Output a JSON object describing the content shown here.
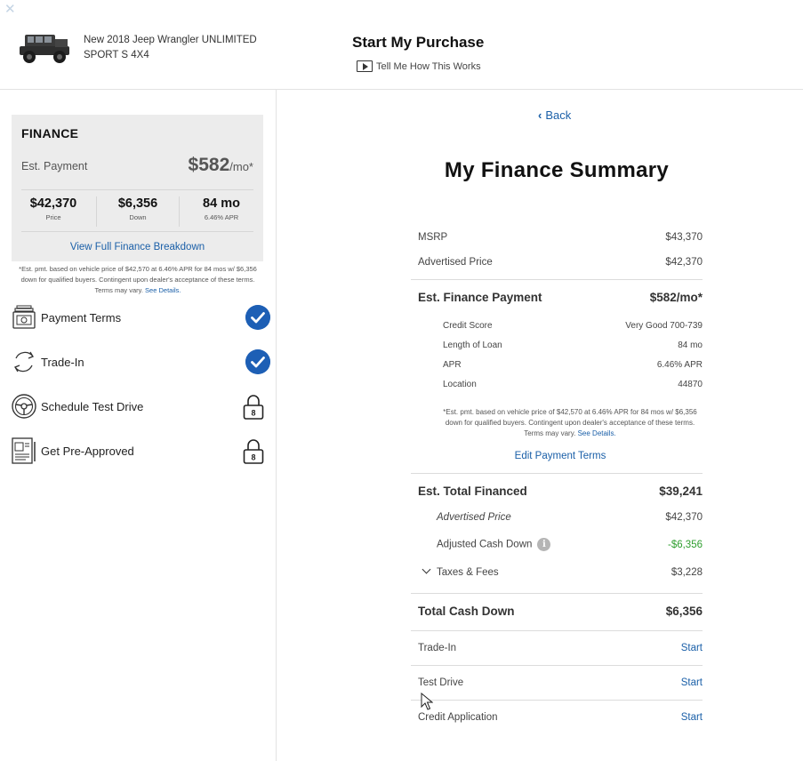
{
  "header": {
    "close_glyph": "✕",
    "vehicle_name": "New 2018 Jeep Wrangler UNLIMITED SPORT S 4X4",
    "title": "Start My Purchase",
    "how_it_works": "Tell Me How This Works"
  },
  "finance_card": {
    "title": "FINANCE",
    "est_label": "Est. Payment",
    "est_amount": "$582",
    "est_suffix": "/mo*",
    "stats": [
      {
        "value": "$42,370",
        "label": "Price"
      },
      {
        "value": "$6,356",
        "label": "Down"
      },
      {
        "value": "84 mo",
        "label": "6.46% APR"
      }
    ],
    "breakdown_link": "View Full Finance Breakdown"
  },
  "left_disclaimer": {
    "text": "*Est. pmt. based on vehicle price of $42,570 at 6.46% APR for 84 mos w/ $6,356 down for qualified buyers. Contingent upon dealer's acceptance of these terms. Terms may vary.",
    "link": "See Details."
  },
  "steps": [
    {
      "label": "Payment Terms",
      "status": "complete"
    },
    {
      "label": "Trade-In",
      "status": "complete"
    },
    {
      "label": "Schedule Test Drive",
      "status": "locked",
      "lock_number": "8"
    },
    {
      "label": "Get Pre-Approved",
      "status": "locked",
      "lock_number": "8"
    }
  ],
  "summary": {
    "back": "Back",
    "title": "My Finance Summary",
    "msrp_label": "MSRP",
    "msrp_value": "$43,370",
    "adv_label": "Advertised Price",
    "adv_value": "$42,370",
    "est_payment_label": "Est. Finance Payment",
    "est_payment_value": "$582/mo*",
    "details": [
      {
        "label": "Credit Score",
        "value": "Very Good 700-739"
      },
      {
        "label": "Length of Loan",
        "value": "84 mo"
      },
      {
        "label": "APR",
        "value": "6.46% APR"
      },
      {
        "label": "Location",
        "value": "44870"
      }
    ],
    "disclaimer": "*Est. pmt. based on vehicle price of $42,570 at 6.46% APR for 84 mos w/ $6,356 down for qualified buyers. Contingent upon dealer's acceptance of these terms. Terms may vary.",
    "disclaimer_link": "See Details.",
    "edit_terms": "Edit Payment Terms",
    "total_financed_label": "Est. Total Financed",
    "total_financed_value": "$39,241",
    "tf_adv_label": "Advertised Price",
    "tf_adv_value": "$42,370",
    "adj_cash_label": "Adjusted Cash Down",
    "adj_cash_value": "-$6,356",
    "taxes_label": "Taxes & Fees",
    "taxes_value": "$3,228",
    "total_cash_label": "Total Cash Down",
    "total_cash_value": "$6,356",
    "actions": [
      {
        "label": "Trade-In",
        "action": "Start"
      },
      {
        "label": "Test Drive",
        "action": "Start"
      },
      {
        "label": "Credit Application",
        "action": "Start"
      }
    ]
  },
  "colors": {
    "link": "#1a5fa8",
    "check": "#1d5fb5",
    "negative_green": "#2e9e2e",
    "card_bg": "#ececec"
  },
  "icons": [
    "close-icon",
    "jeep-thumbnail",
    "play-icon",
    "money-stack-icon",
    "refresh-icon",
    "steering-wheel-icon",
    "document-icon",
    "check-icon",
    "lock-icon",
    "chevron-left-icon",
    "info-icon",
    "chevron-down-icon",
    "cursor-icon"
  ]
}
